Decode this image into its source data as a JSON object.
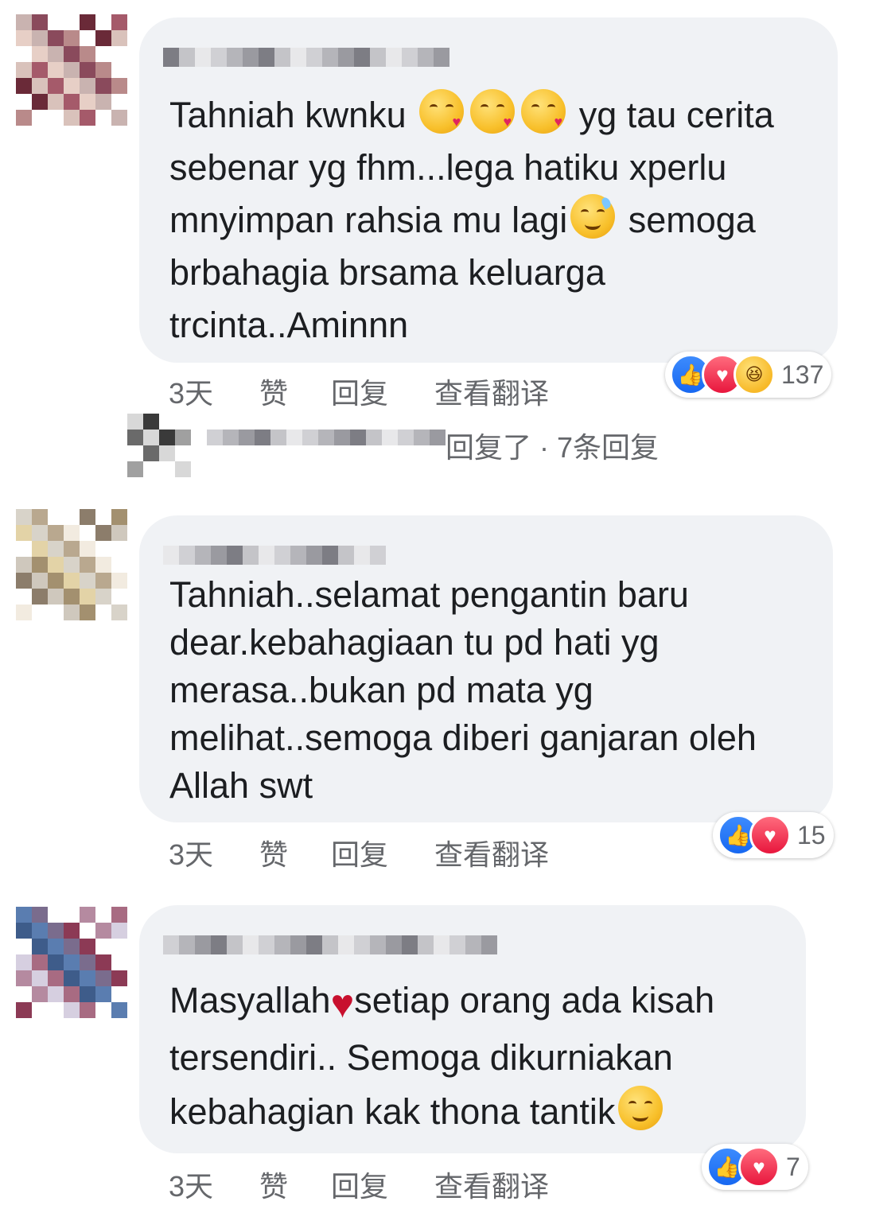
{
  "comments": [
    {
      "text_segments": [
        "Tahniah kwnku ",
        " yg tau cerita\nsebenar yg fhm...lega hatiku xperlu\nmnyimpan rahsia mu lagi",
        " semoga\nbrbahagia brsama keluarga\ntrcinta..Aminnn"
      ],
      "emoji_1": "kissing-heart-emoji",
      "emoji_2": "sweat-smile-emoji",
      "actions": {
        "time": "3天",
        "like": "赞",
        "reply": "回复",
        "translate": "查看翻译"
      },
      "reactions": [
        "like",
        "love",
        "haha"
      ],
      "reaction_count": "137"
    },
    {
      "text": "Tahniah..selamat pengantin baru\ndear.kebahagiaan tu pd hati yg\nmerasa..bukan pd mata yg\nmelihat..semoga diberi ganjaran oleh\nAllah swt",
      "actions": {
        "time": "3天",
        "like": "赞",
        "reply": "回复",
        "translate": "查看翻译"
      },
      "reactions": [
        "like",
        "love"
      ],
      "reaction_count": "15"
    },
    {
      "text_segments": [
        "Masyallah",
        "setiap orang ada kisah\ntersendiri.. Semoga dikurniakan\nkebahagian kak thona tantik"
      ],
      "emoji_heart": "red-heart-emoji",
      "emoji_smile": "smiling-emoji",
      "actions": {
        "time": "3天",
        "like": "赞",
        "reply": "回复",
        "translate": "查看翻译"
      },
      "reactions": [
        "like",
        "love"
      ],
      "reaction_count": "7"
    }
  ],
  "reply_summary": {
    "text": "回复了 · 7条回复"
  },
  "colors": {
    "bubble": "#f0f2f5",
    "text": "#1c1e21",
    "secondary": "#65676b",
    "like": "#1768f1",
    "love": "#e8163d"
  }
}
